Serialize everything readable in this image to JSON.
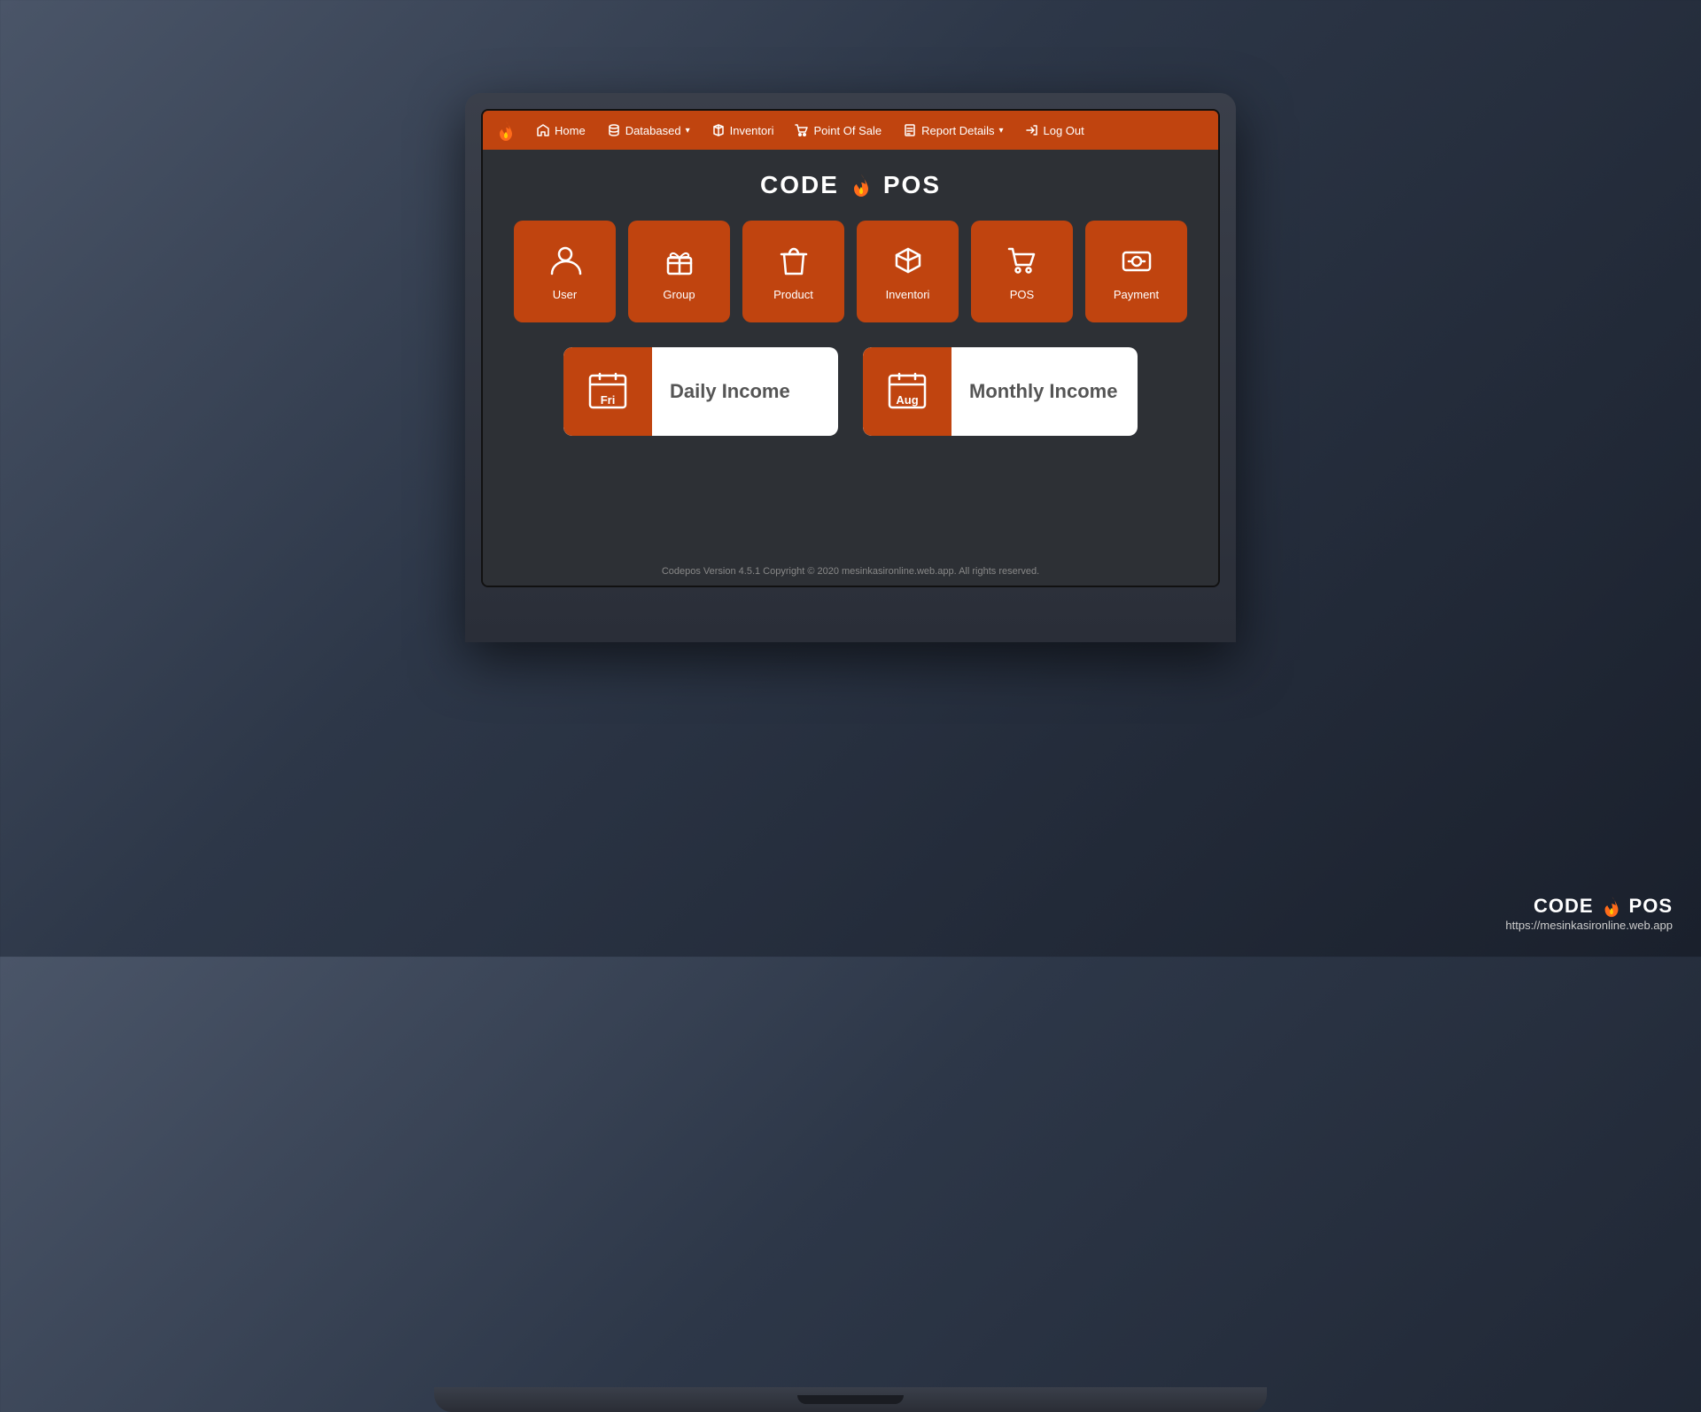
{
  "app": {
    "title_left": "CODE",
    "title_right": "POS",
    "version": "Codepos Version 4.5.1 Copyright © 2020 mesinkasironline.web.app. All rights reserved."
  },
  "navbar": {
    "items": [
      {
        "label": "Home",
        "icon": "home-icon"
      },
      {
        "label": "Databased",
        "icon": "database-icon",
        "has_dropdown": true
      },
      {
        "label": "Inventori",
        "icon": "box-icon"
      },
      {
        "label": "Point Of Sale",
        "icon": "cart-icon"
      },
      {
        "label": "Report Details",
        "icon": "report-icon",
        "has_dropdown": true
      },
      {
        "label": "Log Out",
        "icon": "logout-icon"
      }
    ]
  },
  "icon_grid": {
    "cards": [
      {
        "label": "User",
        "icon": "user-icon"
      },
      {
        "label": "Group",
        "icon": "group-icon"
      },
      {
        "label": "Product",
        "icon": "product-icon"
      },
      {
        "label": "Inventori",
        "icon": "inventori-icon"
      },
      {
        "label": "POS",
        "icon": "pos-icon"
      },
      {
        "label": "Payment",
        "icon": "payment-icon"
      }
    ]
  },
  "income_cards": [
    {
      "day": "Fri",
      "date": "",
      "label": "Daily Income"
    },
    {
      "day": "Aug",
      "date": "",
      "label": "Monthly Income"
    }
  ],
  "watermark": {
    "title_left": "CODE",
    "title_right": "POS",
    "url": "https://mesinkasironline.web.app"
  },
  "colors": {
    "primary": "#c0440f",
    "bg": "#2d3035",
    "navbar": "#c0440f"
  }
}
